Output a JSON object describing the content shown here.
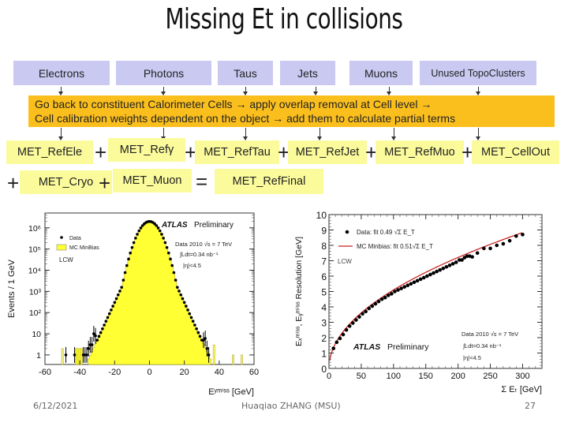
{
  "slide": {
    "title": "Missing Et in collisions",
    "footer": {
      "date": "6/12/2021",
      "author": "Huaqiao ZHANG (MSU)",
      "page": "27"
    }
  },
  "diagram": {
    "objects": [
      "Electrons",
      "Photons",
      "Taus",
      "Jets",
      "Muons",
      "Unused TopoClusters"
    ],
    "process_lines": [
      "Go back to constituent Calorimeter Cells →  apply overlap removal at Cell level →",
      "Cell calibration weights dependent on the object → add them to calculate partial terms"
    ],
    "terms_row1": [
      "MET_RefEle",
      "MET_Refγ",
      "MET_RefTau",
      "MET_RefJet",
      "MET_RefMuo",
      "MET_CellOut"
    ],
    "terms_row2": [
      "MET_Cryo",
      "MET_Muon"
    ],
    "result": "MET_RefFinal",
    "plus": "+",
    "equals": "=",
    "colors": {
      "object_box": "#c9c9f2",
      "process_band": "#fbbf1d",
      "term_box": "#fbfb9c"
    }
  },
  "chart_data": [
    {
      "type": "bar",
      "subtype": "histogram-log",
      "title": "",
      "xlabel": "E_y^miss [GeV]",
      "ylabel": "Events / 1 GeV",
      "xlim": [
        -60,
        60
      ],
      "ylim_log10": [
        -0.45,
        6.7
      ],
      "x_ticks": [
        "-60",
        "-40",
        "-20",
        "0",
        "20",
        "40",
        "60"
      ],
      "y_ticks": [
        "1",
        "10",
        "10²",
        "10³",
        "10⁴",
        "10⁵",
        "10⁶"
      ],
      "legend": {
        "position": "top-left",
        "entries": [
          "Data",
          "MC MinBias"
        ]
      },
      "annotations": [
        "ATLAS",
        "Preliminary",
        "Data 2010  √s = 7 TeV",
        "∫Ldt=0.34 nb⁻¹",
        "|η|<4.5",
        "LCW"
      ],
      "colors": {
        "mc_fill": "#ffff33",
        "data": "#000000"
      },
      "mc_model": {
        "peak": 2000000,
        "core_sigma": 4.2,
        "exp_slope_per_GeV": 0.41
      },
      "mc_isolated_bins": [
        -50,
        -42,
        -41,
        -40,
        -39,
        37,
        48,
        53
      ],
      "data_tail_points": [
        {
          "x": -48,
          "y": 1
        },
        {
          "x": -43,
          "y": 1
        },
        {
          "x": -38,
          "y": 1
        },
        {
          "x": -37,
          "y": 1
        },
        {
          "x": -36,
          "y": 1
        },
        {
          "x": -35,
          "y": 2
        },
        {
          "x": -34,
          "y": 3
        },
        {
          "x": -33,
          "y": 3
        },
        {
          "x": -32,
          "y": 10
        },
        {
          "x": -31,
          "y": 8
        },
        {
          "x": 31,
          "y": 5
        },
        {
          "x": 32,
          "y": 6
        },
        {
          "x": 33,
          "y": 2
        },
        {
          "x": 34,
          "y": 1
        }
      ]
    },
    {
      "type": "scatter",
      "title": "",
      "xlabel": "Σ E_T  [GeV]",
      "ylabel": "E_x^miss, E_y^miss Resolution [GeV]",
      "xlim": [
        0,
        330
      ],
      "ylim": [
        0,
        10
      ],
      "x_ticks": [
        "0",
        "50",
        "100",
        "150",
        "200",
        "250",
        "300"
      ],
      "y_ticks": [
        "0",
        "1",
        "2",
        "3",
        "4",
        "5",
        "6",
        "7",
        "8",
        "9",
        "10"
      ],
      "legend": {
        "position": "top-left",
        "entries": [
          "Data: fit 0.49 √Σ E_T",
          "MC Minbias: fit 0.51√Σ E_T"
        ]
      },
      "annotations": [
        "ATLAS",
        "Preliminary",
        "Data 2010  √s = 7 TeV",
        "∫Ldt=0.34 nb⁻¹",
        "|η|<4.5",
        "LCW"
      ],
      "colors": {
        "data": "#000000",
        "fit_line": "#cc2222"
      },
      "series": [
        {
          "name": "Data",
          "points": [
            [
              7,
              1.3
            ],
            [
              12,
              1.7
            ],
            [
              17,
              1.95
            ],
            [
              22,
              2.2
            ],
            [
              27,
              2.5
            ],
            [
              32,
              2.75
            ],
            [
              37,
              2.95
            ],
            [
              42,
              3.15
            ],
            [
              47,
              3.35
            ],
            [
              52,
              3.55
            ],
            [
              57,
              3.7
            ],
            [
              62,
              3.9
            ],
            [
              67,
              4.05
            ],
            [
              72,
              4.2
            ],
            [
              77,
              4.35
            ],
            [
              82,
              4.5
            ],
            [
              87,
              4.6
            ],
            [
              92,
              4.75
            ],
            [
              97,
              4.85
            ],
            [
              102,
              5.0
            ],
            [
              107,
              5.1
            ],
            [
              112,
              5.2
            ],
            [
              117,
              5.3
            ],
            [
              122,
              5.4
            ],
            [
              127,
              5.5
            ],
            [
              132,
              5.6
            ],
            [
              137,
              5.7
            ],
            [
              142,
              5.8
            ],
            [
              147,
              5.9
            ],
            [
              152,
              6.0
            ],
            [
              157,
              6.1
            ],
            [
              162,
              6.2
            ],
            [
              167,
              6.3
            ],
            [
              172,
              6.4
            ],
            [
              177,
              6.5
            ],
            [
              182,
              6.6
            ],
            [
              187,
              6.7
            ],
            [
              192,
              6.8
            ],
            [
              197,
              6.9
            ],
            [
              202,
              7.05
            ],
            [
              206,
              7.05
            ],
            [
              210,
              7.2
            ],
            [
              214,
              7.3
            ],
            [
              218,
              7.3
            ],
            [
              222,
              7.25
            ],
            [
              230,
              7.5
            ],
            [
              240,
              7.8
            ],
            [
              250,
              7.8
            ],
            [
              260,
              8.0
            ],
            [
              270,
              8.1
            ],
            [
              280,
              8.3
            ],
            [
              290,
              8.6
            ],
            [
              300,
              8.7
            ]
          ]
        },
        {
          "name": "MC Minbias fit",
          "function": "0.51*sqrt(x)",
          "x_range": [
            1,
            300
          ]
        }
      ]
    }
  ]
}
